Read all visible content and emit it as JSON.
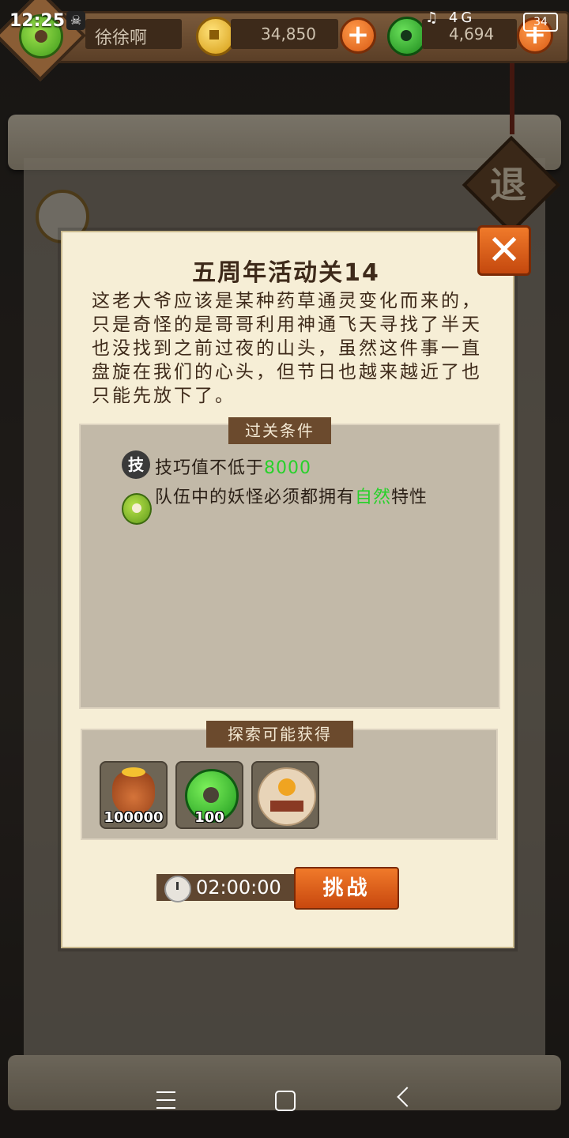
{
  "status_bar": {
    "time": "12:25",
    "network": "4G",
    "battery": "34"
  },
  "top_bar": {
    "player_name": "徐徐啊",
    "gold": "34,850",
    "jade": "4,694"
  },
  "background": {
    "retreat_label": "退"
  },
  "dialog": {
    "title": "五周年活动关14",
    "description": "这老大爷应该是某种药草通灵变化而来的，只是奇怪的是哥哥利用神通飞天寻找了半天也没找到之前过夜的山头，虽然这件事一直盘旋在我们的心头，但节日也越来越近了也只能先放下了。",
    "conditions_label": "过关条件",
    "conditions": [
      {
        "icon": "skill-icon",
        "icon_text": "技",
        "text": "技巧值不低于",
        "highlight": "8000",
        "suffix": ""
      },
      {
        "icon": "nature-icon",
        "icon_text": "",
        "text": "队伍中的妖怪必须都拥有",
        "highlight": "自然",
        "suffix": "特性"
      }
    ],
    "rewards_label": "探索可能获得",
    "rewards": [
      {
        "icon": "gold-bag-icon",
        "amount": "100000"
      },
      {
        "icon": "jade-icon",
        "amount": "100"
      },
      {
        "icon": "treasure-orb-icon",
        "amount": ""
      }
    ],
    "timer": "02:00:00",
    "challenge_label": "挑战"
  },
  "colors": {
    "highlight_green": "#27d12a",
    "button_orange": "#e0631c",
    "dialog_bg": "#f6eed6"
  }
}
